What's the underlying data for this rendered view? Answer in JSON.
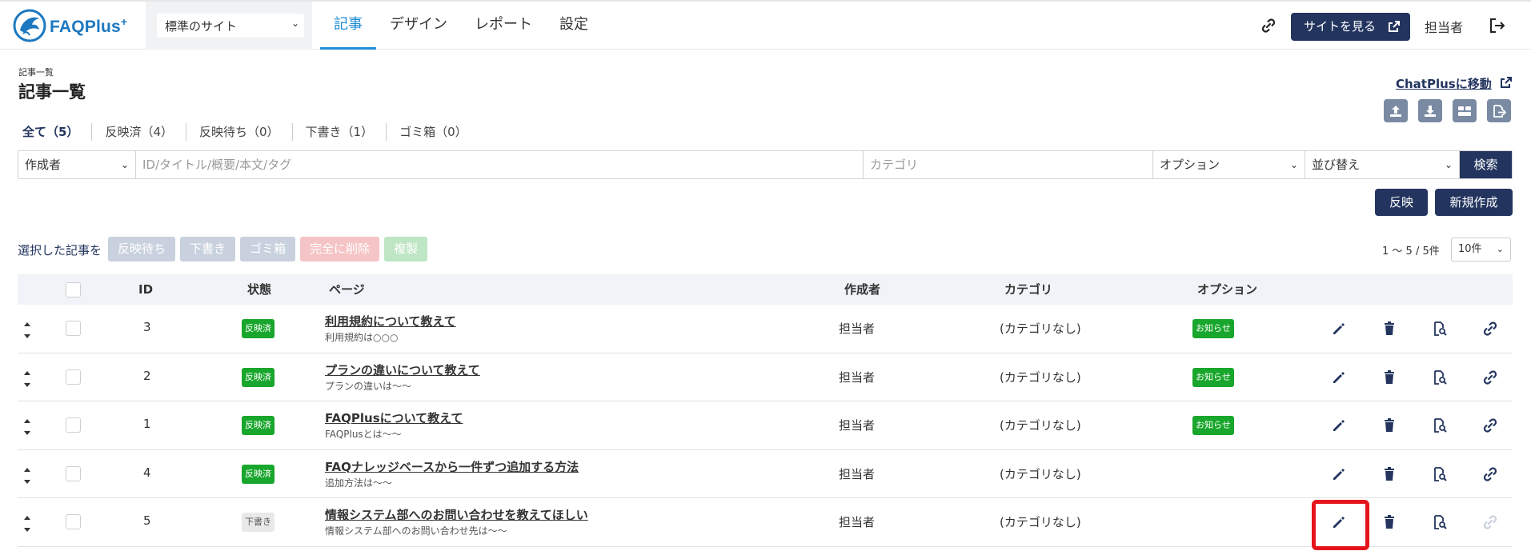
{
  "header": {
    "logo_text": "FAQPlus",
    "logo_plus": "+",
    "site_select": "標準のサイト",
    "nav": [
      "記事",
      "デザイン",
      "レポート",
      "設定"
    ],
    "view_site_button": "サイトを見る",
    "user_name": "担当者"
  },
  "page": {
    "breadcrumb": "記事一覧",
    "title": "記事一覧",
    "chatplus_link": "ChatPlusに移動"
  },
  "tabs": [
    {
      "label": "全て（5）"
    },
    {
      "label": "反映済（4）"
    },
    {
      "label": "反映待ち（0）"
    },
    {
      "label": "下書き（1）"
    },
    {
      "label": "ゴミ箱（0）"
    }
  ],
  "filter": {
    "author": "作成者",
    "keyword_placeholder": "ID/タイトル/概要/本文/タグ",
    "category_placeholder": "カテゴリ",
    "option": "オプション",
    "sort": "並び替え",
    "search_button": "検索"
  },
  "actions": {
    "publish_button": "反映",
    "new_button": "新規作成"
  },
  "bulk": {
    "label": "選択した記事を",
    "buttons": [
      {
        "label": "反映待ち",
        "color": "#c9d1de"
      },
      {
        "label": "下書き",
        "color": "#c9d1de"
      },
      {
        "label": "ゴミ箱",
        "color": "#c9d1de"
      },
      {
        "label": "完全に削除",
        "color": "#f5c4c6"
      },
      {
        "label": "複製",
        "color": "#bfe6c4"
      }
    ]
  },
  "pagination": {
    "summary": "1 ～ 5 / 5件",
    "per_page": "10件"
  },
  "table": {
    "headers": {
      "id": "ID",
      "status": "状態",
      "page": "ページ",
      "author": "作成者",
      "category": "カテゴリ",
      "option": "オプション"
    },
    "rows": [
      {
        "id": "3",
        "status": "反映済",
        "title": "利用規約について教えて",
        "summary": "利用規約は○○○",
        "author": "担当者",
        "category": "(カテゴリなし)",
        "option": "お知らせ"
      },
      {
        "id": "2",
        "status": "反映済",
        "title": "プランの違いについて教えて",
        "summary": "プランの違いは～～",
        "author": "担当者",
        "category": "(カテゴリなし)",
        "option": "お知らせ"
      },
      {
        "id": "1",
        "status": "反映済",
        "title": "FAQPlusについて教えて",
        "summary": "FAQPlusとは～～",
        "author": "担当者",
        "category": "(カテゴリなし)",
        "option": "お知らせ"
      },
      {
        "id": "4",
        "status": "反映済",
        "title": "FAQナレッジベースから一件ずつ追加する方法",
        "summary": "追加方法は～～",
        "author": "担当者",
        "category": "(カテゴリなし)",
        "option": ""
      },
      {
        "id": "5",
        "status": "下書き",
        "title": "情報システム部へのお問い合わせを教えてほしい",
        "summary": "情報システム部へのお問い合わせ先は～～",
        "author": "担当者",
        "category": "(カテゴリなし)",
        "option": ""
      }
    ]
  },
  "colors": {
    "navy": "#23355f",
    "accent_blue": "#1f8dd6",
    "published_green": "#19a62c",
    "highlight_red": "#e5141b"
  },
  "icons": [
    "link-icon",
    "external-link-icon",
    "logout-icon",
    "upload-icon",
    "download-icon",
    "layout-icon",
    "export-icon",
    "sort-icon",
    "edit-icon",
    "trash-icon",
    "preview-icon",
    "copy-link-icon"
  ]
}
